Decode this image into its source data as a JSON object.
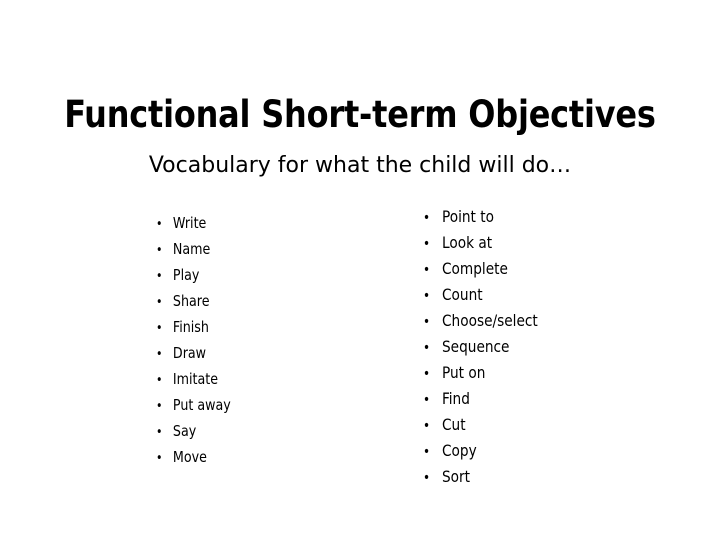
{
  "slide": {
    "title": "Functional Short-term Objectives",
    "subtitle": "Vocabulary for what the child will do…",
    "background_color": "#ffffff",
    "text_color": "#000000",
    "bullet_glyph": "•",
    "columns": {
      "left": {
        "items": [
          {
            "label": "Write"
          },
          {
            "label": "Name"
          },
          {
            "label": "Play"
          },
          {
            "label": "Share"
          },
          {
            "label": "Finish"
          },
          {
            "label": "Draw"
          },
          {
            "label": "Imitate"
          },
          {
            "label": "Put away"
          },
          {
            "label": "Say"
          },
          {
            "label": "Move"
          }
        ]
      },
      "right": {
        "items": [
          {
            "label": "Point to"
          },
          {
            "label": "Look at"
          },
          {
            "label": "Complete"
          },
          {
            "label": "Count"
          },
          {
            "label": "Choose/select"
          },
          {
            "label": "Sequence"
          },
          {
            "label": "Put on"
          },
          {
            "label": "Find"
          },
          {
            "label": "Cut"
          },
          {
            "label": "Copy"
          },
          {
            "label": "Sort"
          }
        ]
      }
    }
  }
}
